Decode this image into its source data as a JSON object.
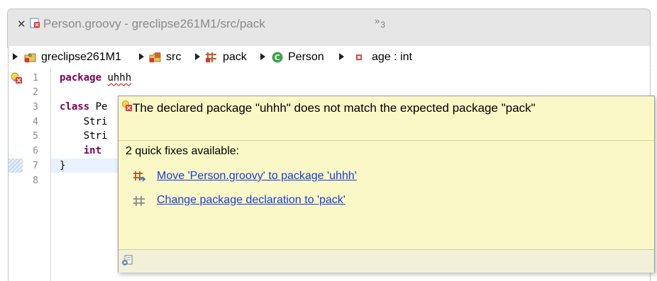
{
  "tab": {
    "close_icon": "close-icon",
    "file_icon": "groovy-file-error-icon",
    "title": "Person.groovy - greclipse261M1/src/pack",
    "overflow_count": "3"
  },
  "breadcrumb": {
    "items": [
      {
        "label": "greclipse261M1",
        "icon": "groovy-project-icon"
      },
      {
        "label": "src",
        "icon": "source-folder-icon"
      },
      {
        "label": "pack",
        "icon": "package-icon"
      },
      {
        "label": "Person",
        "icon": "class-icon"
      },
      {
        "label": "age : int",
        "icon": "field-icon"
      }
    ]
  },
  "editor": {
    "line_numbers": [
      "1",
      "2",
      "3",
      "4",
      "5",
      "6",
      "7",
      "8"
    ],
    "lines": [
      {
        "kw": "package ",
        "rest": "",
        "err": "uhhh"
      },
      {
        "kw": "",
        "rest": "",
        "err": ""
      },
      {
        "kw": "class ",
        "rest": "Pe",
        "err": ""
      },
      {
        "kw": "",
        "rest": "    Stri",
        "err": ""
      },
      {
        "kw": "",
        "rest": "    Stri",
        "err": ""
      },
      {
        "kw": "    int",
        "rest": "",
        "err": ""
      },
      {
        "kw": "",
        "rest": "}",
        "err": ""
      },
      {
        "kw": "",
        "rest": "",
        "err": ""
      }
    ]
  },
  "popup": {
    "message": "The declared package \"uhhh\" does not match the expected package \"pack\"",
    "fixes_available": "2 quick fixes available:",
    "fixes": [
      {
        "label": "Move 'Person.groovy' to package 'uhhh'",
        "icon": "move-package-icon"
      },
      {
        "label": "Change package declaration to 'pack'",
        "icon": "package-icon"
      }
    ],
    "bottom_icon": "configure-icon"
  },
  "colors": {
    "keyword": "#7f0055",
    "link": "#1a3cd6",
    "popup_bg": "#fbf8c7",
    "error": "#d00000",
    "current_line": "#e8f2fe"
  }
}
